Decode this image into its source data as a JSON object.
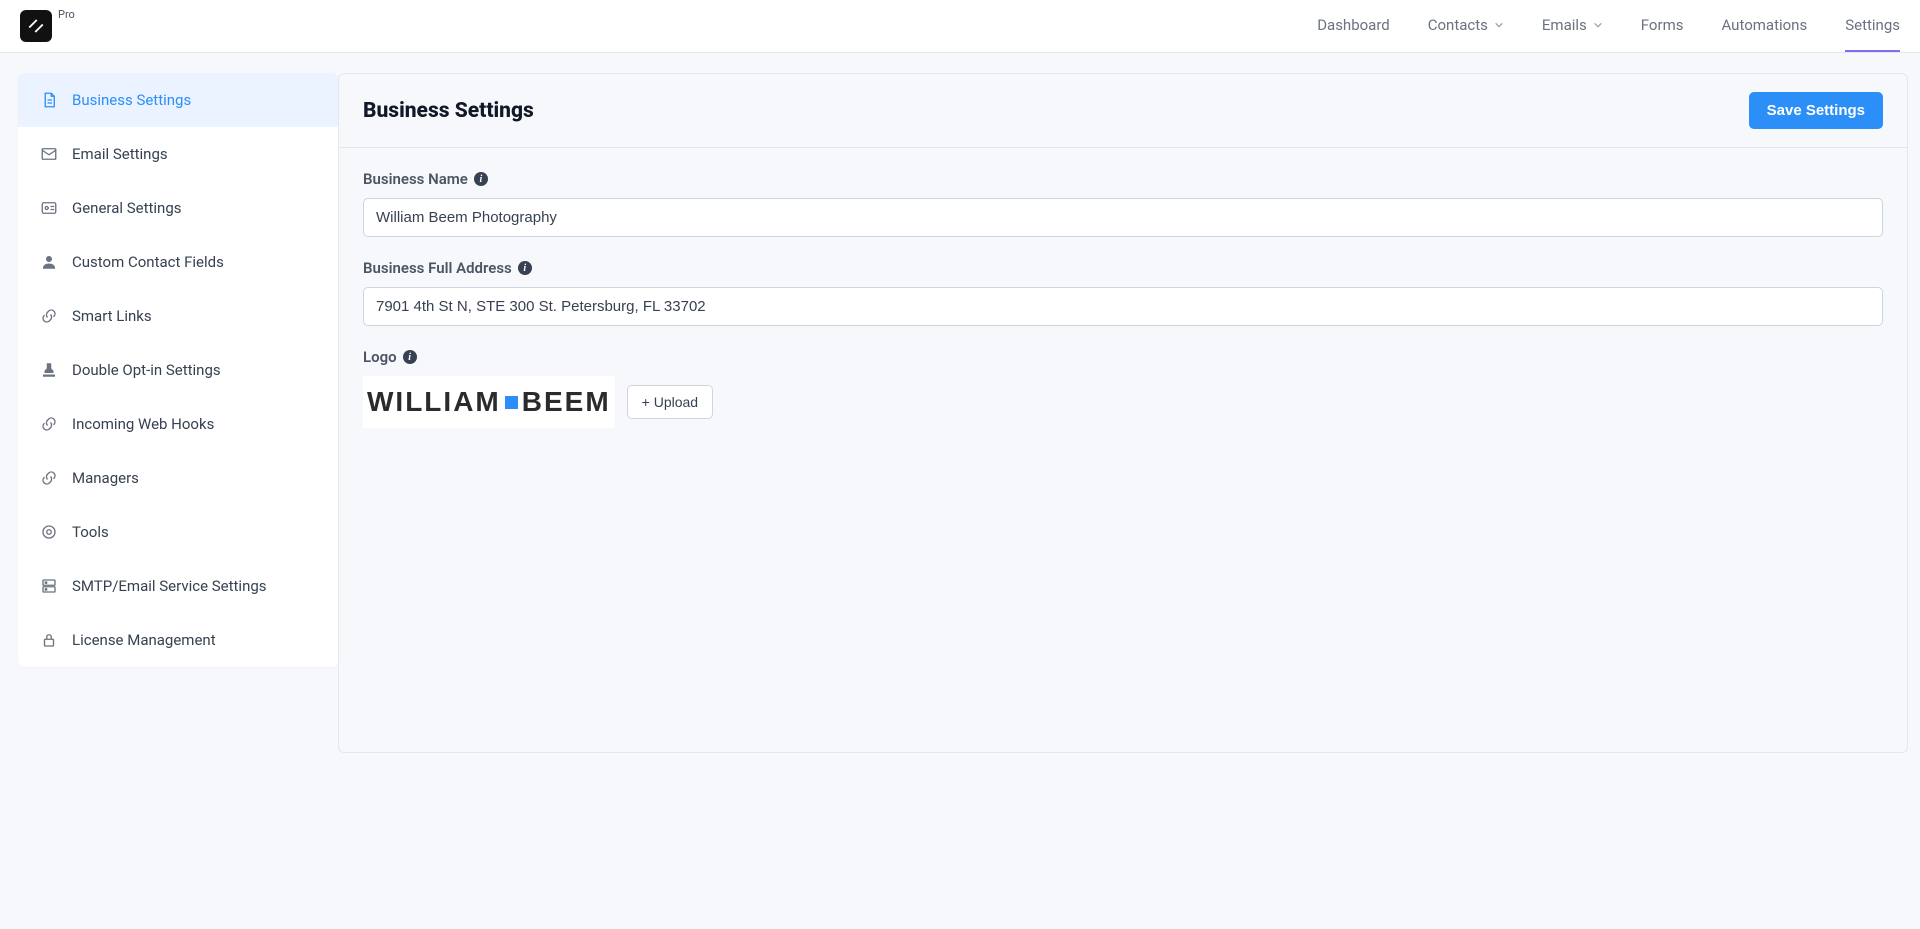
{
  "header": {
    "brand_suffix": "Pro",
    "nav": [
      {
        "label": "Dashboard",
        "dropdown": false,
        "active": false
      },
      {
        "label": "Contacts",
        "dropdown": true,
        "active": false
      },
      {
        "label": "Emails",
        "dropdown": true,
        "active": false
      },
      {
        "label": "Forms",
        "dropdown": false,
        "active": false
      },
      {
        "label": "Automations",
        "dropdown": false,
        "active": false
      },
      {
        "label": "Settings",
        "dropdown": false,
        "active": true
      }
    ]
  },
  "sidebar": {
    "items": [
      {
        "label": "Business Settings",
        "icon": "document-icon",
        "active": true
      },
      {
        "label": "Email Settings",
        "icon": "envelope-icon",
        "active": false
      },
      {
        "label": "General Settings",
        "icon": "settings-card-icon",
        "active": false
      },
      {
        "label": "Custom Contact Fields",
        "icon": "person-icon",
        "active": false
      },
      {
        "label": "Smart Links",
        "icon": "link-icon",
        "active": false
      },
      {
        "label": "Double Opt-in Settings",
        "icon": "stamp-icon",
        "active": false
      },
      {
        "label": "Incoming Web Hooks",
        "icon": "link-icon",
        "active": false
      },
      {
        "label": "Managers",
        "icon": "link-icon",
        "active": false
      },
      {
        "label": "Tools",
        "icon": "gear-icon",
        "active": false
      },
      {
        "label": "SMTP/Email Service Settings",
        "icon": "server-icon",
        "active": false
      },
      {
        "label": "License Management",
        "icon": "lock-icon",
        "active": false
      }
    ]
  },
  "page": {
    "title": "Business Settings",
    "save_label": "Save Settings",
    "fields": {
      "business_name": {
        "label": "Business Name",
        "value": "William Beem Photography"
      },
      "business_address": {
        "label": "Business Full Address",
        "value": "7901 4th St N, STE 300 St. Petersburg, FL 33702"
      },
      "logo": {
        "label": "Logo",
        "upload_label": "+ Upload",
        "preview_text_left": "WILLIAM",
        "preview_text_right": "BEEM"
      }
    }
  }
}
